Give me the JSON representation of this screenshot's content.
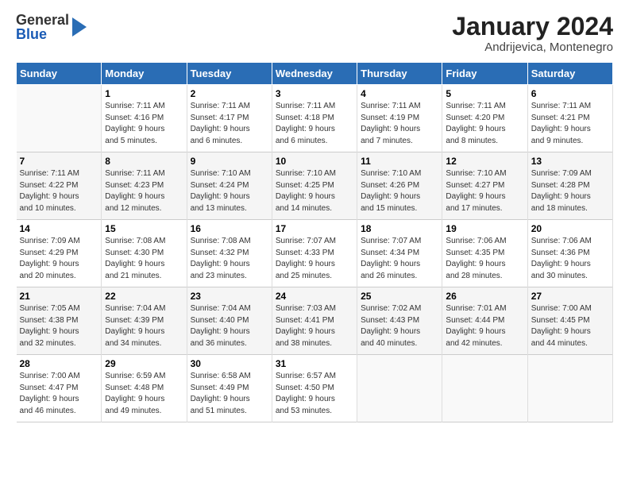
{
  "logo": {
    "general": "General",
    "blue": "Blue"
  },
  "header": {
    "title": "January 2024",
    "subtitle": "Andrijevica, Montenegro"
  },
  "weekdays": [
    "Sunday",
    "Monday",
    "Tuesday",
    "Wednesday",
    "Thursday",
    "Friday",
    "Saturday"
  ],
  "weeks": [
    [
      {
        "day": "",
        "info": ""
      },
      {
        "day": "1",
        "info": "Sunrise: 7:11 AM\nSunset: 4:16 PM\nDaylight: 9 hours\nand 5 minutes."
      },
      {
        "day": "2",
        "info": "Sunrise: 7:11 AM\nSunset: 4:17 PM\nDaylight: 9 hours\nand 6 minutes."
      },
      {
        "day": "3",
        "info": "Sunrise: 7:11 AM\nSunset: 4:18 PM\nDaylight: 9 hours\nand 6 minutes."
      },
      {
        "day": "4",
        "info": "Sunrise: 7:11 AM\nSunset: 4:19 PM\nDaylight: 9 hours\nand 7 minutes."
      },
      {
        "day": "5",
        "info": "Sunrise: 7:11 AM\nSunset: 4:20 PM\nDaylight: 9 hours\nand 8 minutes."
      },
      {
        "day": "6",
        "info": "Sunrise: 7:11 AM\nSunset: 4:21 PM\nDaylight: 9 hours\nand 9 minutes."
      }
    ],
    [
      {
        "day": "7",
        "info": "Sunrise: 7:11 AM\nSunset: 4:22 PM\nDaylight: 9 hours\nand 10 minutes."
      },
      {
        "day": "8",
        "info": "Sunrise: 7:11 AM\nSunset: 4:23 PM\nDaylight: 9 hours\nand 12 minutes."
      },
      {
        "day": "9",
        "info": "Sunrise: 7:10 AM\nSunset: 4:24 PM\nDaylight: 9 hours\nand 13 minutes."
      },
      {
        "day": "10",
        "info": "Sunrise: 7:10 AM\nSunset: 4:25 PM\nDaylight: 9 hours\nand 14 minutes."
      },
      {
        "day": "11",
        "info": "Sunrise: 7:10 AM\nSunset: 4:26 PM\nDaylight: 9 hours\nand 15 minutes."
      },
      {
        "day": "12",
        "info": "Sunrise: 7:10 AM\nSunset: 4:27 PM\nDaylight: 9 hours\nand 17 minutes."
      },
      {
        "day": "13",
        "info": "Sunrise: 7:09 AM\nSunset: 4:28 PM\nDaylight: 9 hours\nand 18 minutes."
      }
    ],
    [
      {
        "day": "14",
        "info": "Sunrise: 7:09 AM\nSunset: 4:29 PM\nDaylight: 9 hours\nand 20 minutes."
      },
      {
        "day": "15",
        "info": "Sunrise: 7:08 AM\nSunset: 4:30 PM\nDaylight: 9 hours\nand 21 minutes."
      },
      {
        "day": "16",
        "info": "Sunrise: 7:08 AM\nSunset: 4:32 PM\nDaylight: 9 hours\nand 23 minutes."
      },
      {
        "day": "17",
        "info": "Sunrise: 7:07 AM\nSunset: 4:33 PM\nDaylight: 9 hours\nand 25 minutes."
      },
      {
        "day": "18",
        "info": "Sunrise: 7:07 AM\nSunset: 4:34 PM\nDaylight: 9 hours\nand 26 minutes."
      },
      {
        "day": "19",
        "info": "Sunrise: 7:06 AM\nSunset: 4:35 PM\nDaylight: 9 hours\nand 28 minutes."
      },
      {
        "day": "20",
        "info": "Sunrise: 7:06 AM\nSunset: 4:36 PM\nDaylight: 9 hours\nand 30 minutes."
      }
    ],
    [
      {
        "day": "21",
        "info": "Sunrise: 7:05 AM\nSunset: 4:38 PM\nDaylight: 9 hours\nand 32 minutes."
      },
      {
        "day": "22",
        "info": "Sunrise: 7:04 AM\nSunset: 4:39 PM\nDaylight: 9 hours\nand 34 minutes."
      },
      {
        "day": "23",
        "info": "Sunrise: 7:04 AM\nSunset: 4:40 PM\nDaylight: 9 hours\nand 36 minutes."
      },
      {
        "day": "24",
        "info": "Sunrise: 7:03 AM\nSunset: 4:41 PM\nDaylight: 9 hours\nand 38 minutes."
      },
      {
        "day": "25",
        "info": "Sunrise: 7:02 AM\nSunset: 4:43 PM\nDaylight: 9 hours\nand 40 minutes."
      },
      {
        "day": "26",
        "info": "Sunrise: 7:01 AM\nSunset: 4:44 PM\nDaylight: 9 hours\nand 42 minutes."
      },
      {
        "day": "27",
        "info": "Sunrise: 7:00 AM\nSunset: 4:45 PM\nDaylight: 9 hours\nand 44 minutes."
      }
    ],
    [
      {
        "day": "28",
        "info": "Sunrise: 7:00 AM\nSunset: 4:47 PM\nDaylight: 9 hours\nand 46 minutes."
      },
      {
        "day": "29",
        "info": "Sunrise: 6:59 AM\nSunset: 4:48 PM\nDaylight: 9 hours\nand 49 minutes."
      },
      {
        "day": "30",
        "info": "Sunrise: 6:58 AM\nSunset: 4:49 PM\nDaylight: 9 hours\nand 51 minutes."
      },
      {
        "day": "31",
        "info": "Sunrise: 6:57 AM\nSunset: 4:50 PM\nDaylight: 9 hours\nand 53 minutes."
      },
      {
        "day": "",
        "info": ""
      },
      {
        "day": "",
        "info": ""
      },
      {
        "day": "",
        "info": ""
      }
    ]
  ]
}
